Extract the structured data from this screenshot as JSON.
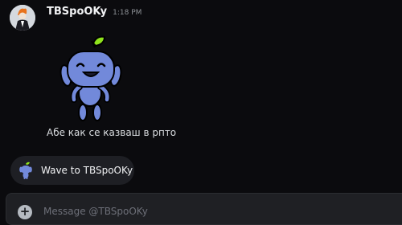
{
  "message": {
    "author": "TBSpoOKy",
    "timestamp": "1:18 PM",
    "sticker_icon": "wumpus-wave-sticker",
    "text": "Абе как се казваш в рпто"
  },
  "wave_button": {
    "label": "Wave to TBSpoOKy",
    "icon": "wumpus-mini-icon"
  },
  "composer": {
    "placeholder": "Message @TBSpoOKy",
    "value": "",
    "add_icon": "plus-circle-icon"
  },
  "colors": {
    "background": "#0b0b0e",
    "wumpus": "#7289da",
    "leaf": "#8fe31c",
    "button_bg": "#1e1f24"
  }
}
